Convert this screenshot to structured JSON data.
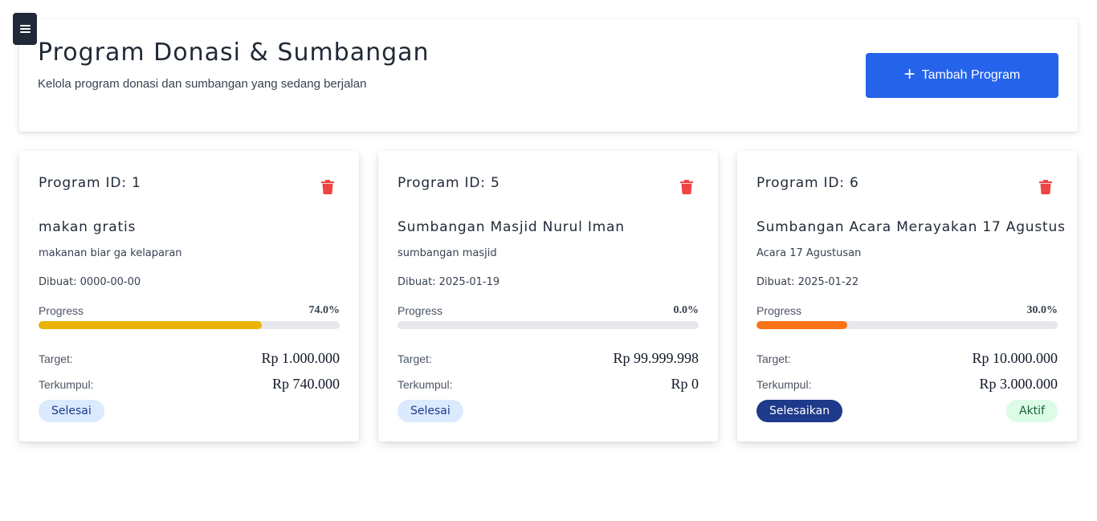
{
  "header": {
    "title": "Program Donasi & Sumbangan",
    "subtitle": "Kelola program donasi dan sumbangan yang sedang berjalan",
    "add_button_label": "Tambah Program",
    "add_button_icon": "plus-icon",
    "menu_icon": "hamburger-icon"
  },
  "labels": {
    "date_prefix": "Dibuat:",
    "progress": "Progress",
    "target": "Target:",
    "collected": "Terkumpul:"
  },
  "colors": {
    "primary": "#2563eb",
    "delete": "#ef4444",
    "progress_yellow": "#eab308",
    "progress_orange": "#f97316",
    "status_blue_bg": "#dbeafe",
    "finish_button": "#1e3a8a",
    "active_bg": "#dcfce7"
  },
  "programs": [
    {
      "id_label": "Program ID: 1",
      "title": "makan gratis",
      "description": "makanan biar ga kelaparan",
      "date": "0000-00-00",
      "progress_text": "74.0%",
      "progress_fraction": 0.74,
      "progress_color": "#eab308",
      "target": "Rp 1.000.000",
      "collected": "Rp 740.000",
      "status": "Selesai"
    },
    {
      "id_label": "Program ID: 5",
      "title": "Sumbangan Masjid Nurul Iman",
      "description": "sumbangan masjid",
      "date": "2025-01-19",
      "progress_text": "0.0%",
      "progress_fraction": 0.0,
      "progress_color": "#eab308",
      "target": "Rp 99.999.998",
      "collected": "Rp 0",
      "status": "Selesai"
    },
    {
      "id_label": "Program ID: 6",
      "title": "Sumbangan Acara Merayakan 17 Agustus",
      "description": "Acara 17 Agustusan",
      "date": "2025-01-22",
      "progress_text": "30.0%",
      "progress_fraction": 0.3,
      "progress_color": "#f97316",
      "target": "Rp 10.000.000",
      "collected": "Rp 3.000.000",
      "finish_button": "Selesaikan",
      "active_badge": "Aktif"
    }
  ]
}
